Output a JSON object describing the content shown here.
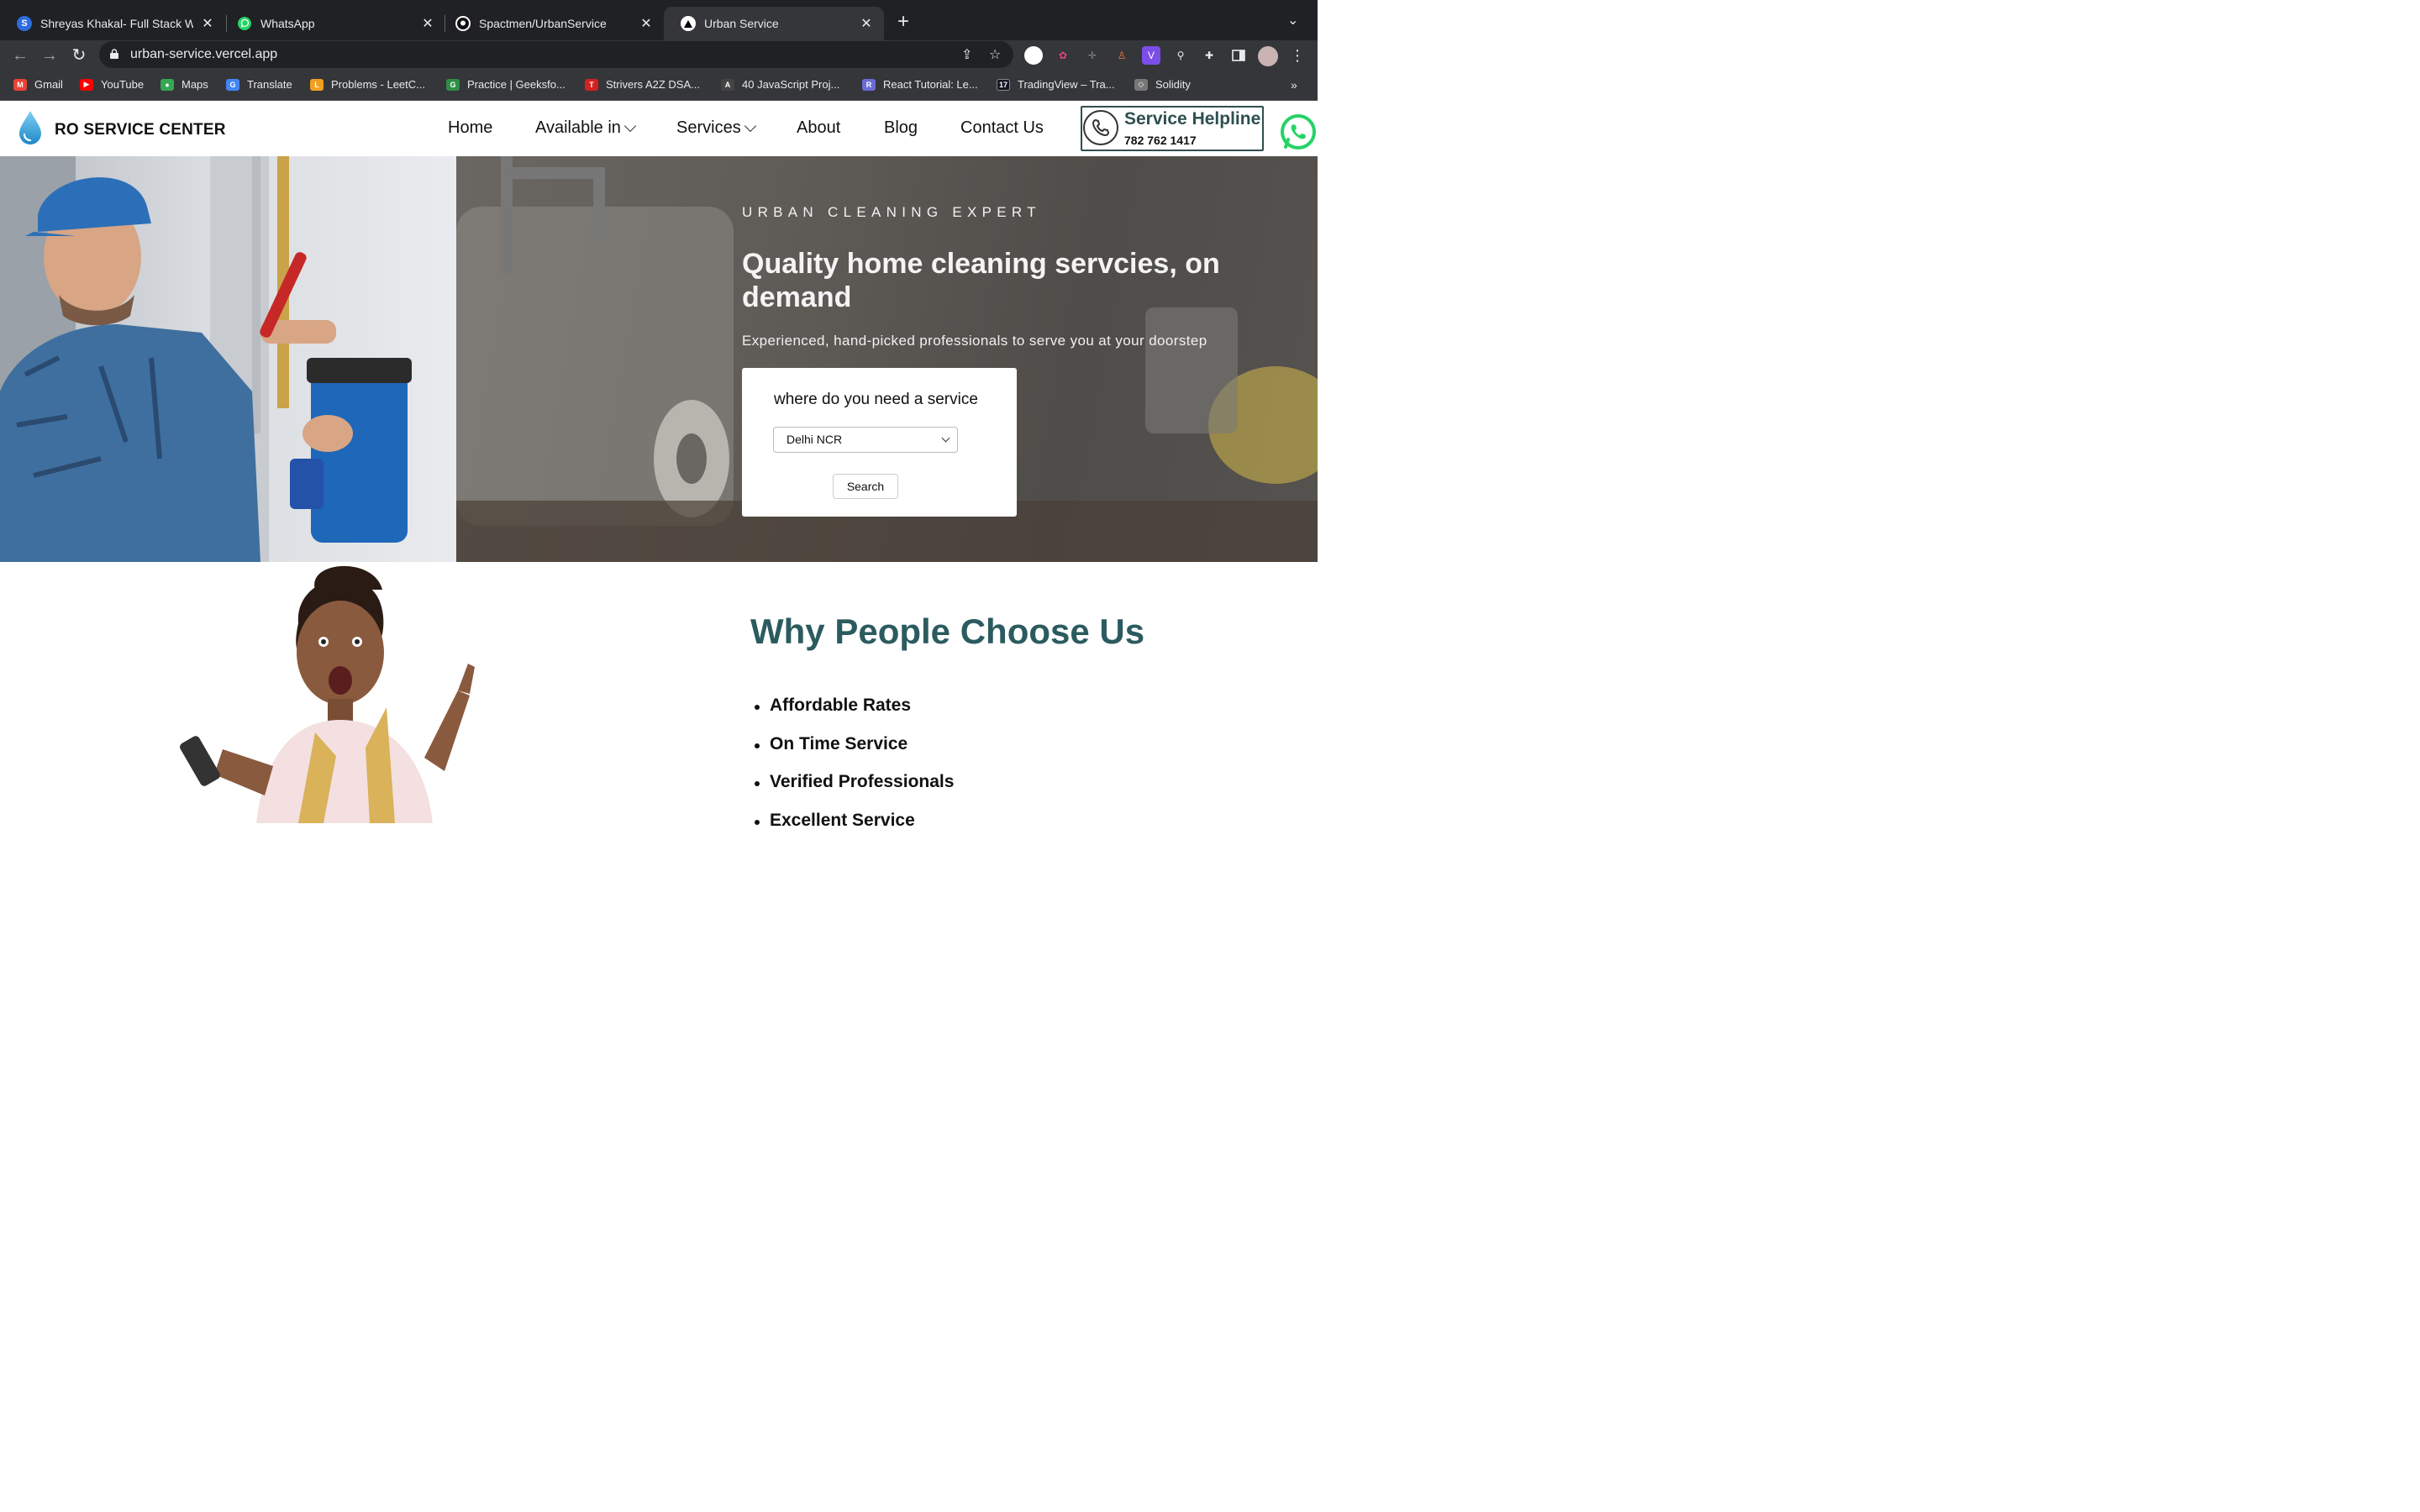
{
  "browser": {
    "tabs": [
      {
        "title": "Shreyas Khakal- Full Stack We",
        "favicon": "S",
        "active": false
      },
      {
        "title": "WhatsApp",
        "favicon": "whatsapp-icon",
        "active": false
      },
      {
        "title": "Spactmen/UrbanService",
        "favicon": "github-icon",
        "active": false
      },
      {
        "title": "Urban Service",
        "favicon": "vercel-icon",
        "active": true
      }
    ],
    "new_tab": "+",
    "url": "urban-service.vercel.app",
    "bookmarks": [
      {
        "label": "Gmail",
        "icon": "gmail-icon",
        "color": "#ea4335"
      },
      {
        "label": "YouTube",
        "icon": "youtube-icon",
        "color": "#ff0000"
      },
      {
        "label": "Maps",
        "icon": "maps-icon",
        "color": "#34a853"
      },
      {
        "label": "Translate",
        "icon": "translate-icon",
        "color": "#4285f4"
      },
      {
        "label": "Problems - LeetC...",
        "icon": "leetcode-icon",
        "color": "#f0a020"
      },
      {
        "label": "Practice | Geeksfo...",
        "icon": "gfg-icon",
        "color": "#2f8d46"
      },
      {
        "label": "Strivers A2Z DSA...",
        "icon": "tuf-icon",
        "color": "#d42020"
      },
      {
        "label": "40 JavaScript Proj...",
        "icon": "js-icon",
        "color": "#444"
      },
      {
        "label": "React Tutorial: Le...",
        "icon": "react-icon",
        "color": "#6b6bd6"
      },
      {
        "label": "TradingView – Tra...",
        "icon": "tradingview-icon",
        "color": "#131722"
      },
      {
        "label": "Solidity",
        "icon": "solidity-icon",
        "color": "#777"
      }
    ],
    "bookmarks_more": "»"
  },
  "site": {
    "brand": "RO SERVICE CENTER",
    "nav": [
      {
        "label": "Home",
        "dropdown": false
      },
      {
        "label": "Available in",
        "dropdown": true
      },
      {
        "label": "Services",
        "dropdown": true
      },
      {
        "label": "About",
        "dropdown": false
      },
      {
        "label": "Blog",
        "dropdown": false
      },
      {
        "label": "Contact Us",
        "dropdown": false
      }
    ],
    "helpline": {
      "title": "Service Helpline",
      "number": "782 762 1417"
    },
    "accent": "#2b5b5e"
  },
  "hero": {
    "eyebrow": "URBAN CLEANING EXPERT",
    "headline": "Quality home cleaning servcies, on demand",
    "subline": "Experienced, hand-picked professionals to serve you at your doorstep",
    "card": {
      "question": "where do you need a service",
      "selected_city": "Delhi NCR",
      "search_label": "Search"
    }
  },
  "why": {
    "title": "Why People Choose Us",
    "items": [
      "Affordable Rates",
      "On Time Service",
      "Verified Professionals",
      "Excellent Service"
    ]
  }
}
